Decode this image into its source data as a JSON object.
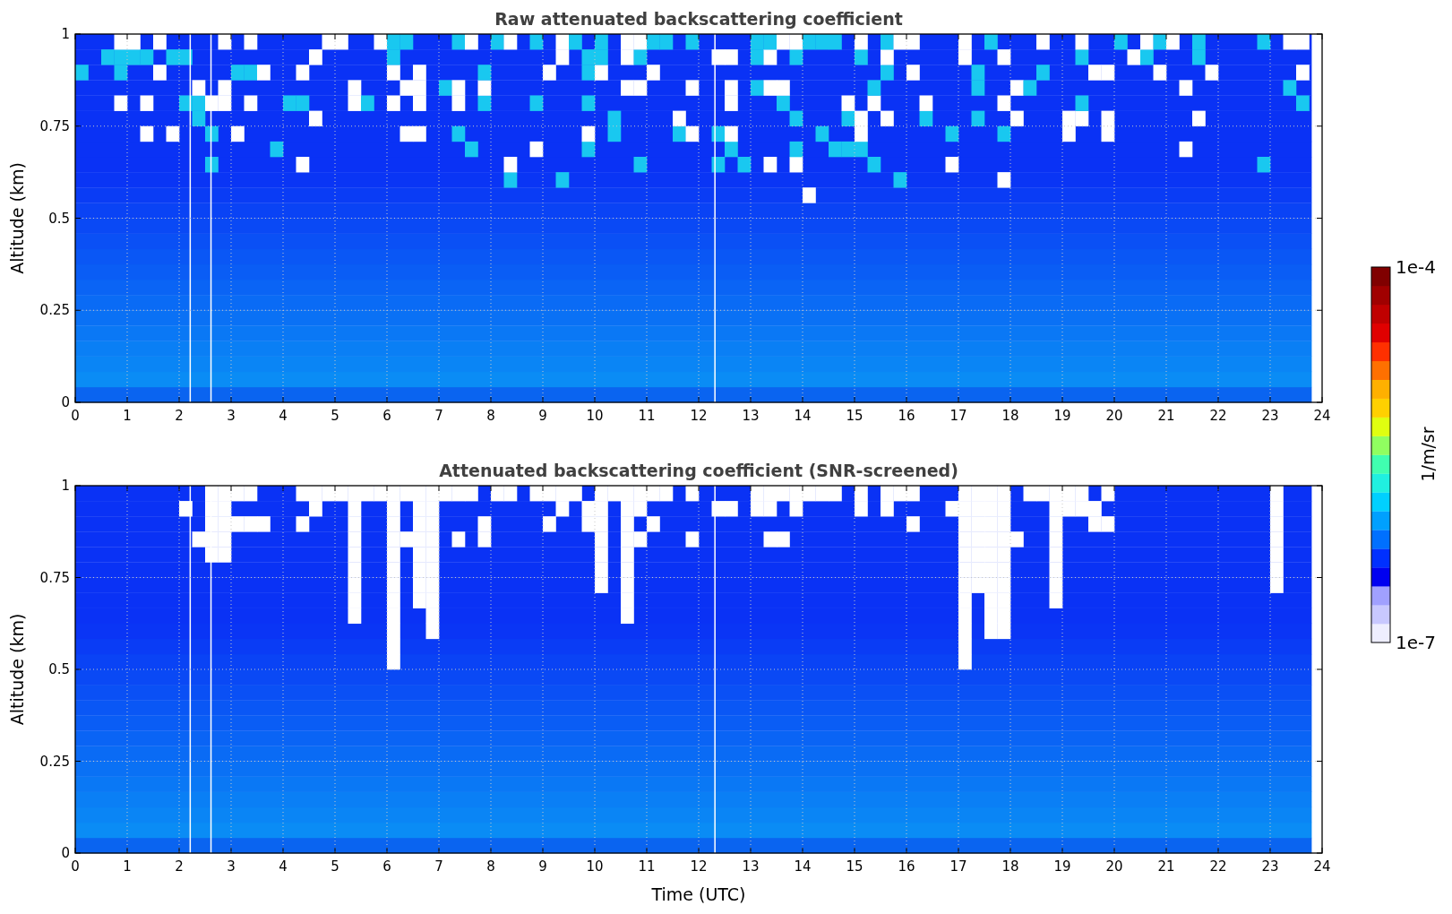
{
  "plots": [
    {
      "title": "Raw attenuated backscattering coefficient",
      "ylabel": "Altitude (km)",
      "yticks": [
        "1",
        "0.75",
        "0.5",
        "0.25",
        "0"
      ],
      "xticks": [
        "0",
        "1",
        "2",
        "3",
        "4",
        "5",
        "6",
        "7",
        "8",
        "9",
        "10",
        "11",
        "12",
        "13",
        "14",
        "15",
        "16",
        "17",
        "18",
        "19",
        "20",
        "21",
        "22",
        "23",
        "24"
      ],
      "kind": "raw"
    },
    {
      "title": "Attenuated backscattering coefficient (SNR-screened)",
      "ylabel": "Altitude (km)",
      "yticks": [
        "1",
        "0.75",
        "0.5",
        "0.25",
        "0"
      ],
      "xticks": [
        "0",
        "1",
        "2",
        "3",
        "4",
        "5",
        "6",
        "7",
        "8",
        "9",
        "10",
        "11",
        "12",
        "13",
        "14",
        "15",
        "16",
        "17",
        "18",
        "19",
        "20",
        "21",
        "22",
        "23",
        "24"
      ],
      "xlabel": "Time (UTC)",
      "kind": "screened"
    }
  ],
  "colorbar": {
    "max": "1e-4",
    "min": "1e-7",
    "label": "1/m/sr"
  }
}
